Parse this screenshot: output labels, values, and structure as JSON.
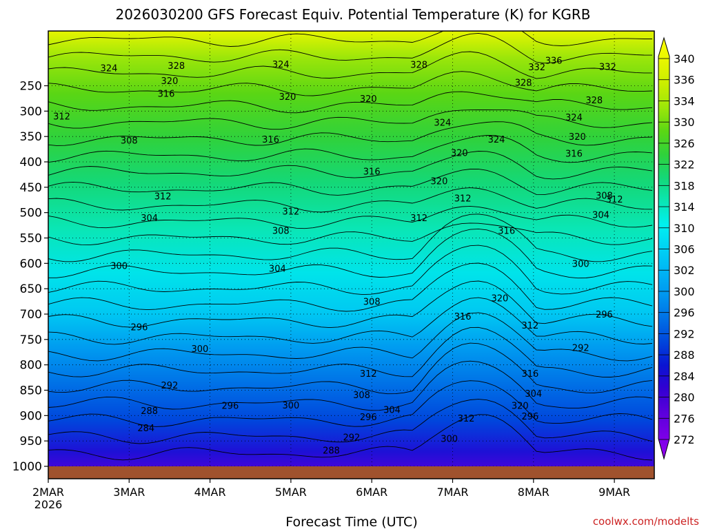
{
  "chart_data": {
    "type": "heatmap",
    "title": "2026030200 GFS Forecast Equiv. Potential Temperature (K) for KGRB",
    "xlabel": "Forecast Time (UTC)",
    "ylabel": "",
    "x_ticks": [
      "2MAR",
      "3MAR",
      "4MAR",
      "5MAR",
      "6MAR",
      "7MAR",
      "8MAR",
      "9MAR"
    ],
    "x_start_year": "2026",
    "xlim": [
      "2026-03-02 00Z",
      "2026-03-09 12Z"
    ],
    "y_ticks": [
      250,
      300,
      350,
      400,
      450,
      500,
      550,
      600,
      650,
      700,
      750,
      800,
      850,
      900,
      950,
      1000
    ],
    "ylim": [
      1000,
      200
    ],
    "y_unit": "hPa",
    "colorbar": {
      "labels": [
        340,
        336,
        334,
        330,
        326,
        322,
        318,
        314,
        310,
        306,
        302,
        300,
        296,
        292,
        288,
        284,
        280,
        276,
        272
      ],
      "colors": [
        "#ffff00",
        "#e6f500",
        "#c8ee00",
        "#9be60a",
        "#5ad614",
        "#2fd23c",
        "#14d878",
        "#0ae6b4",
        "#00f0f0",
        "#00d2f5",
        "#00b4f5",
        "#0096f0",
        "#0070e6",
        "#0046dc",
        "#0a14d2",
        "#3200d2",
        "#5a00dc",
        "#7800e6",
        "#9600f0"
      ],
      "units": "K"
    },
    "grid": true,
    "contour_labels": [
      {
        "value": "324",
        "time": "2MAR 18Z",
        "p": 215
      },
      {
        "value": "328",
        "time": "3MAR 14Z",
        "p": 210
      },
      {
        "value": "324",
        "time": "4MAR 21Z",
        "p": 207
      },
      {
        "value": "328",
        "time": "6MAR 14Z",
        "p": 208
      },
      {
        "value": "336",
        "time": "8MAR 06Z",
        "p": 200
      },
      {
        "value": "332",
        "time": "8MAR 01Z",
        "p": 213
      },
      {
        "value": "332",
        "time": "8MAR 22Z",
        "p": 212
      },
      {
        "value": "328",
        "time": "7MAR 21Z",
        "p": 243
      },
      {
        "value": "320",
        "time": "3MAR 12Z",
        "p": 240
      },
      {
        "value": "316",
        "time": "3MAR 11Z",
        "p": 265
      },
      {
        "value": "320",
        "time": "4MAR 23Z",
        "p": 271
      },
      {
        "value": "320",
        "time": "5MAR 23Z",
        "p": 275
      },
      {
        "value": "328",
        "time": "8MAR 18Z",
        "p": 278
      },
      {
        "value": "312",
        "time": "2MAR 04Z",
        "p": 310
      },
      {
        "value": "324",
        "time": "6MAR 21Z",
        "p": 322
      },
      {
        "value": "324",
        "time": "8MAR 12Z",
        "p": 312
      },
      {
        "value": "308",
        "time": "3MAR 00Z",
        "p": 357
      },
      {
        "value": "316",
        "time": "4MAR 18Z",
        "p": 355
      },
      {
        "value": "324",
        "time": "7MAR 13Z",
        "p": 355
      },
      {
        "value": "320",
        "time": "8MAR 13Z",
        "p": 350
      },
      {
        "value": "320",
        "time": "7MAR 02Z",
        "p": 382
      },
      {
        "value": "316",
        "time": "8MAR 12Z",
        "p": 383
      },
      {
        "value": "316",
        "time": "6MAR 00Z",
        "p": 418
      },
      {
        "value": "320",
        "time": "6MAR 20Z",
        "p": 437
      },
      {
        "value": "312",
        "time": "3MAR 10Z",
        "p": 467
      },
      {
        "value": "312",
        "time": "7MAR 03Z",
        "p": 471
      },
      {
        "value": "308",
        "time": "8MAR 21Z",
        "p": 466
      },
      {
        "value": "312",
        "time": "9MAR 00Z",
        "p": 473
      },
      {
        "value": "304",
        "time": "3MAR 06Z",
        "p": 510
      },
      {
        "value": "312",
        "time": "5MAR 00Z",
        "p": 497
      },
      {
        "value": "312",
        "time": "6MAR 14Z",
        "p": 510
      },
      {
        "value": "304",
        "time": "8MAR 20Z",
        "p": 504
      },
      {
        "value": "308",
        "time": "4MAR 21Z",
        "p": 535
      },
      {
        "value": "316",
        "time": "7MAR 16Z",
        "p": 535
      },
      {
        "value": "300",
        "time": "2MAR 21Z",
        "p": 604
      },
      {
        "value": "304",
        "time": "4MAR 20Z",
        "p": 610
      },
      {
        "value": "300",
        "time": "8MAR 14Z",
        "p": 600
      },
      {
        "value": "308",
        "time": "6MAR 00Z",
        "p": 675
      },
      {
        "value": "320",
        "time": "7MAR 14Z",
        "p": 668
      },
      {
        "value": "316",
        "time": "7MAR 03Z",
        "p": 704
      },
      {
        "value": "296",
        "time": "8MAR 21Z",
        "p": 700
      },
      {
        "value": "296",
        "time": "3MAR 03Z",
        "p": 725
      },
      {
        "value": "312",
        "time": "7MAR 23Z",
        "p": 722
      },
      {
        "value": "300",
        "time": "3MAR 21Z",
        "p": 768
      },
      {
        "value": "292",
        "time": "8MAR 14Z",
        "p": 766
      },
      {
        "value": "312",
        "time": "5MAR 23Z",
        "p": 817
      },
      {
        "value": "316",
        "time": "7MAR 23Z",
        "p": 817
      },
      {
        "value": "292",
        "time": "3MAR 12Z",
        "p": 840
      },
      {
        "value": "308",
        "time": "5MAR 21Z",
        "p": 859
      },
      {
        "value": "304",
        "time": "8MAR 00Z",
        "p": 856
      },
      {
        "value": "296",
        "time": "4MAR 06Z",
        "p": 880
      },
      {
        "value": "300",
        "time": "5MAR 00Z",
        "p": 879
      },
      {
        "value": "288",
        "time": "3MAR 06Z",
        "p": 890
      },
      {
        "value": "304",
        "time": "6MAR 06Z",
        "p": 888
      },
      {
        "value": "320",
        "time": "7MAR 20Z",
        "p": 880
      },
      {
        "value": "296",
        "time": "5MAR 23Z",
        "p": 902
      },
      {
        "value": "312",
        "time": "7MAR 04Z",
        "p": 905
      },
      {
        "value": "296",
        "time": "7MAR 23Z",
        "p": 901
      },
      {
        "value": "284",
        "time": "3MAR 05Z",
        "p": 924
      },
      {
        "value": "292",
        "time": "5MAR 18Z",
        "p": 942
      },
      {
        "value": "300",
        "time": "6MAR 23Z",
        "p": 945
      },
      {
        "value": "288",
        "time": "5MAR 12Z",
        "p": 968
      }
    ]
  },
  "watermark": "coolwx.com/modelts",
  "ground_color": "#a0522d"
}
